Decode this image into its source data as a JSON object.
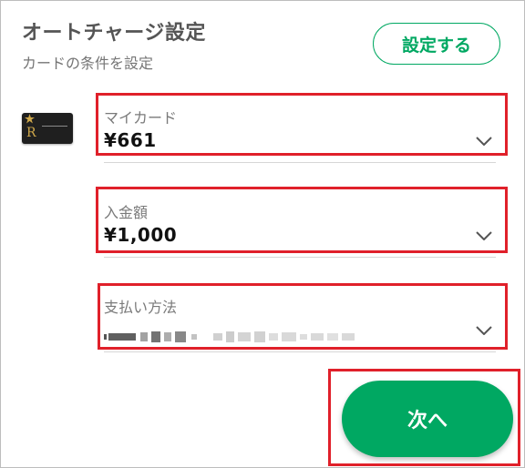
{
  "header": {
    "title": "オートチャージ設定",
    "subtitle": "カードの条件を設定",
    "setup_button_label": "設定する"
  },
  "fields": [
    {
      "label": "マイカード",
      "value": "¥661"
    },
    {
      "label": "入金額",
      "value": "¥1,000"
    },
    {
      "label": "支払い方法",
      "value": ""
    }
  ],
  "footer": {
    "next_button_label": "次へ"
  },
  "icons": {
    "card": "card-thumbnail-icon",
    "dropdown": "chevron-down-icon"
  },
  "colors": {
    "accent": "#00a862",
    "highlight": "#e0202a",
    "title": "#555555",
    "label": "#7a7a7a"
  }
}
